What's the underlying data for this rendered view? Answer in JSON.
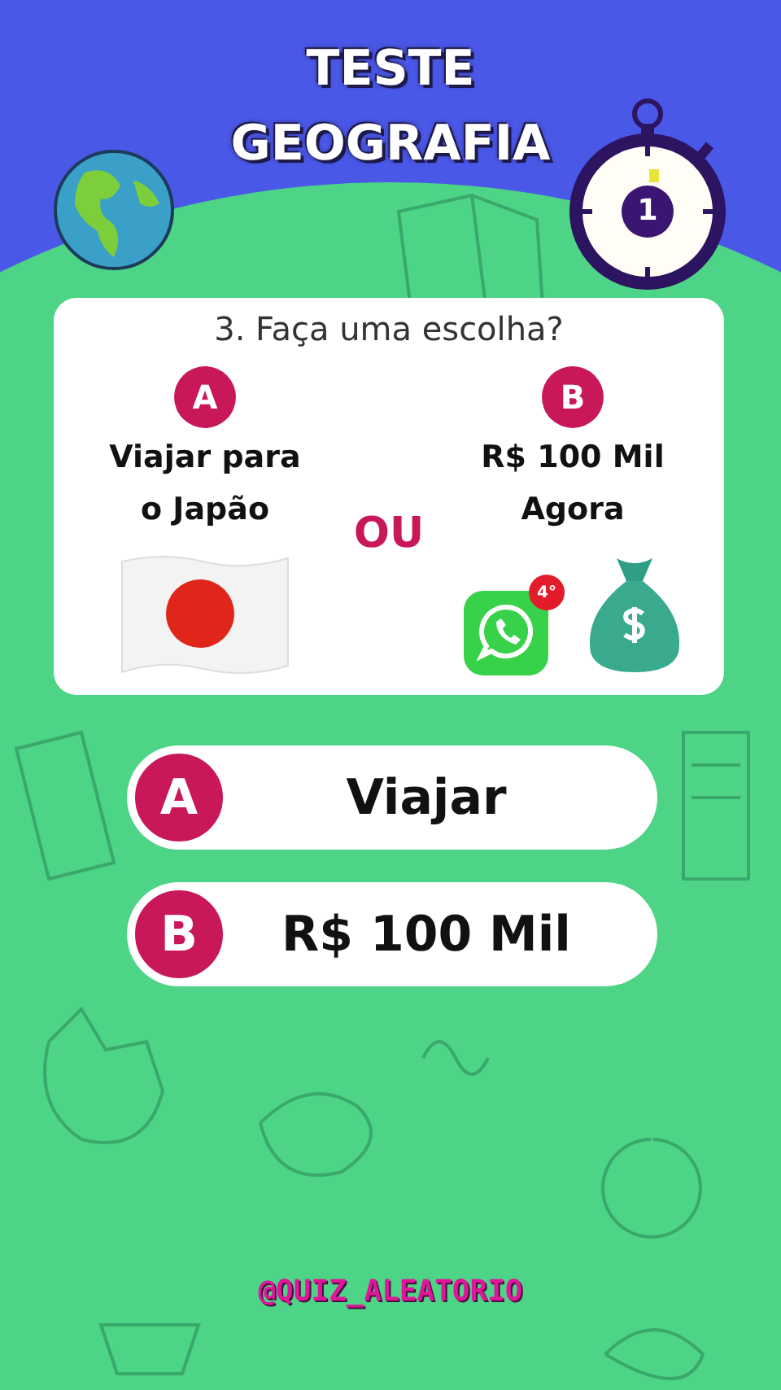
{
  "header": {
    "title_lines": [
      "TESTE",
      "GEOGRAFIA"
    ]
  },
  "timer": {
    "count": "1"
  },
  "question": {
    "text": "3. Faça uma escolha?",
    "separator": "OU",
    "options": [
      {
        "letter": "A",
        "caption_lines": [
          "Viajar para",
          "o Japão"
        ],
        "kind": "flag"
      },
      {
        "letter": "B",
        "caption_lines": [
          "R$ 100 Mil",
          "Agora"
        ],
        "kind": "chat_money",
        "badge": "4°"
      }
    ]
  },
  "answers": [
    {
      "letter": "A",
      "label": "Viajar"
    },
    {
      "letter": "B",
      "label": "R$ 100 Mil"
    }
  ],
  "handle": "@QUIZ_ALEATORIO"
}
